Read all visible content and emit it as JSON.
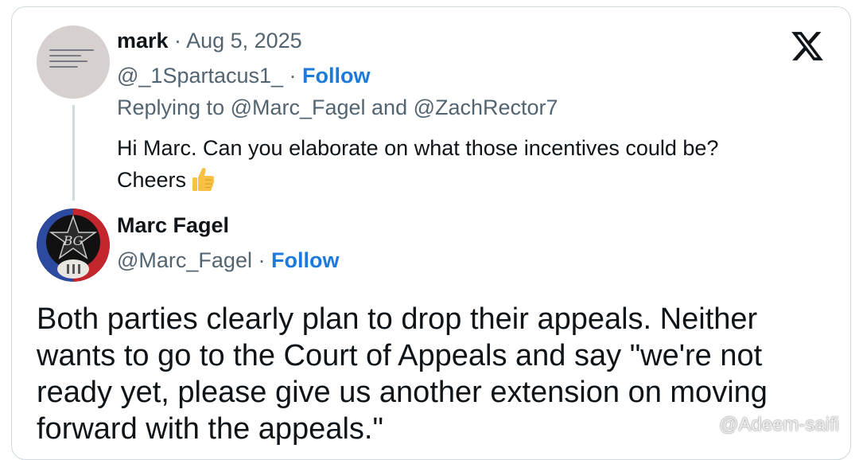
{
  "reply": {
    "name": "mark",
    "separator": " · ",
    "date": "Aug 5, 2025",
    "handle": "@_1Spartacus1_",
    "follow": "Follow",
    "replying": "Replying to @Marc_Fagel and @ZachRector7",
    "text_line1": "Hi Marc. Can you elaborate on what those incentives could be?",
    "text_line2": "Cheers"
  },
  "tweet": {
    "name": "Marc Fagel",
    "handle": "@Marc_Fagel",
    "separator": " · ",
    "follow": "Follow",
    "text": "Both parties clearly plan to drop their appeals. Neither wants to go to the Court of Appeals and say \"we're not ready yet, please give us another extension on moving forward with the appeals.\""
  },
  "watermark": "@Adeem-saifi",
  "colors": {
    "follow": "#1d7ad8",
    "muted": "#536471",
    "border": "#cfd9de"
  },
  "icons": [
    "x-logo-icon",
    "thumbs-up-emoji-icon",
    "watermark-diamond-icon"
  ]
}
